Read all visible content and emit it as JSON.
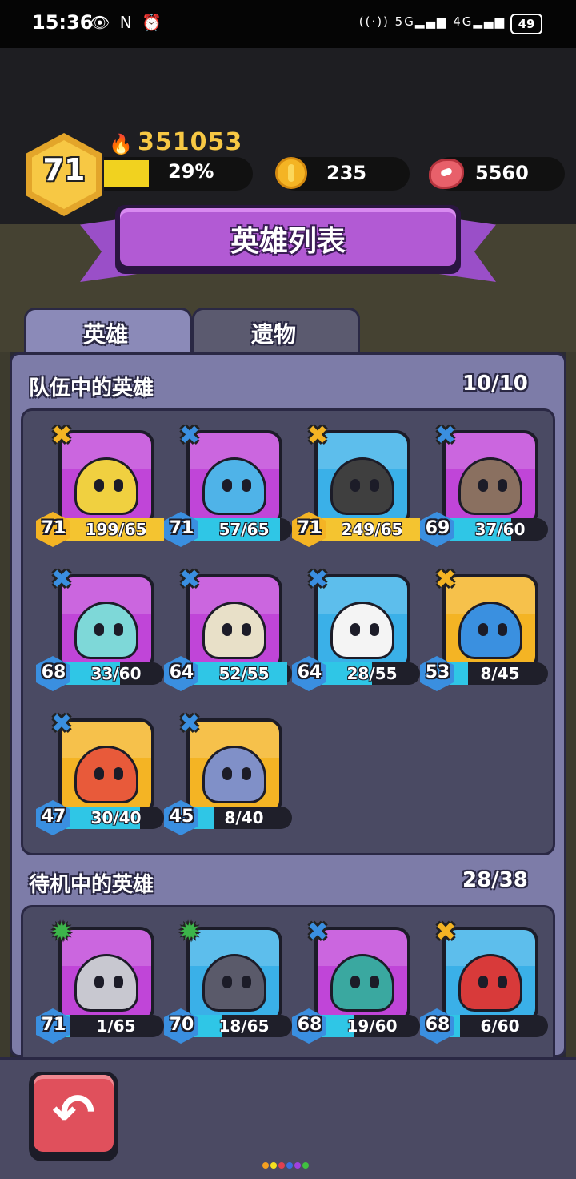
{
  "status_bar": {
    "time": "15:36",
    "left_icons": "👁 N ⏰",
    "right_icons": "((·)) 5G▂▄▆ 4G▂▄▆",
    "battery": "49"
  },
  "player": {
    "level": "71",
    "power": "351053",
    "exp_progress": 0.29,
    "exp_percent": "29%",
    "coins": "235",
    "meat": "5560"
  },
  "title": "英雄列表",
  "tabs": [
    {
      "label": "英雄",
      "active": true
    },
    {
      "label": "遗物",
      "active": false
    }
  ],
  "team": {
    "header": "队伍中的英雄",
    "count": "10/10",
    "heroes": [
      {
        "level": "71",
        "cards": "199/65",
        "progress": 1.0,
        "rank": "gold",
        "bg": "#c045d8",
        "face": "#f0d040",
        "icon": "bandit-hero-icon"
      },
      {
        "level": "71",
        "cards": "57/65",
        "progress": 0.88,
        "rank": "blue",
        "bg": "#c045d8",
        "face": "#4fb3e8",
        "icon": "miner-hero-icon"
      },
      {
        "level": "71",
        "cards": "249/65",
        "progress": 1.0,
        "rank": "gold",
        "bg": "#3ab0e8",
        "face": "#3f3f3f",
        "icon": "cat-hero-icon"
      },
      {
        "level": "69",
        "cards": "37/60",
        "progress": 0.62,
        "rank": "blue",
        "bg": "#c045d8",
        "face": "#8a7060",
        "icon": "tree-hero-icon"
      },
      {
        "level": "68",
        "cards": "33/60",
        "progress": 0.55,
        "rank": "blue",
        "bg": "#c045d8",
        "face": "#7ed8d8",
        "icon": "bunny-hero-icon"
      },
      {
        "level": "64",
        "cards": "52/55",
        "progress": 0.95,
        "rank": "blue",
        "bg": "#c045d8",
        "face": "#e8e0c8",
        "icon": "mummy-hero-icon"
      },
      {
        "level": "64",
        "cards": "28/55",
        "progress": 0.51,
        "rank": "blue",
        "bg": "#3ab0e8",
        "face": "#f4f4f4",
        "icon": "snowman-hero-icon"
      },
      {
        "level": "53",
        "cards": "8/45",
        "progress": 0.18,
        "rank": "gold",
        "bg": "#f4b424",
        "face": "#3a90e0",
        "icon": "knight-hero-icon"
      },
      {
        "level": "47",
        "cards": "30/40",
        "progress": 0.75,
        "rank": "blue",
        "bg": "#f4b424",
        "face": "#e85a3a",
        "icon": "snail-hero-icon"
      },
      {
        "level": "45",
        "cards": "8/40",
        "progress": 0.2,
        "rank": "blue",
        "bg": "#f4b424",
        "face": "#8090c8",
        "icon": "ghost-hero-icon"
      }
    ]
  },
  "standby": {
    "header": "待机中的英雄",
    "count": "28/38",
    "heroes": [
      {
        "level": "71",
        "cards": "1/65",
        "progress": 0.02,
        "rank": "green",
        "bg": "#c045d8",
        "face": "#c8c8d0",
        "icon": "robot-hero-icon"
      },
      {
        "level": "70",
        "cards": "18/65",
        "progress": 0.28,
        "rank": "green",
        "bg": "#3ab0e8",
        "face": "#5a5a6a",
        "icon": "golem-hero-icon"
      },
      {
        "level": "68",
        "cards": "19/60",
        "progress": 0.32,
        "rank": "blue",
        "bg": "#c045d8",
        "face": "#3aa8a0",
        "icon": "dino-hero-icon"
      },
      {
        "level": "68",
        "cards": "6/60",
        "progress": 0.1,
        "rank": "gold",
        "bg": "#3ab0e8",
        "face": "#d83a3a",
        "icon": "warrior-hero-icon"
      }
    ]
  },
  "back_label": "↶",
  "page_dots": [
    "#f4a020",
    "#f4e020",
    "#e04050",
    "#3a70e0",
    "#a040e0",
    "#40c040"
  ],
  "colors": {
    "gold_rank": "#f4b424",
    "blue_rank": "#3a8fe0",
    "green_rank": "#3cb44a",
    "gold_fill": "#f4c430",
    "blue_fill": "#2fc6e6"
  }
}
